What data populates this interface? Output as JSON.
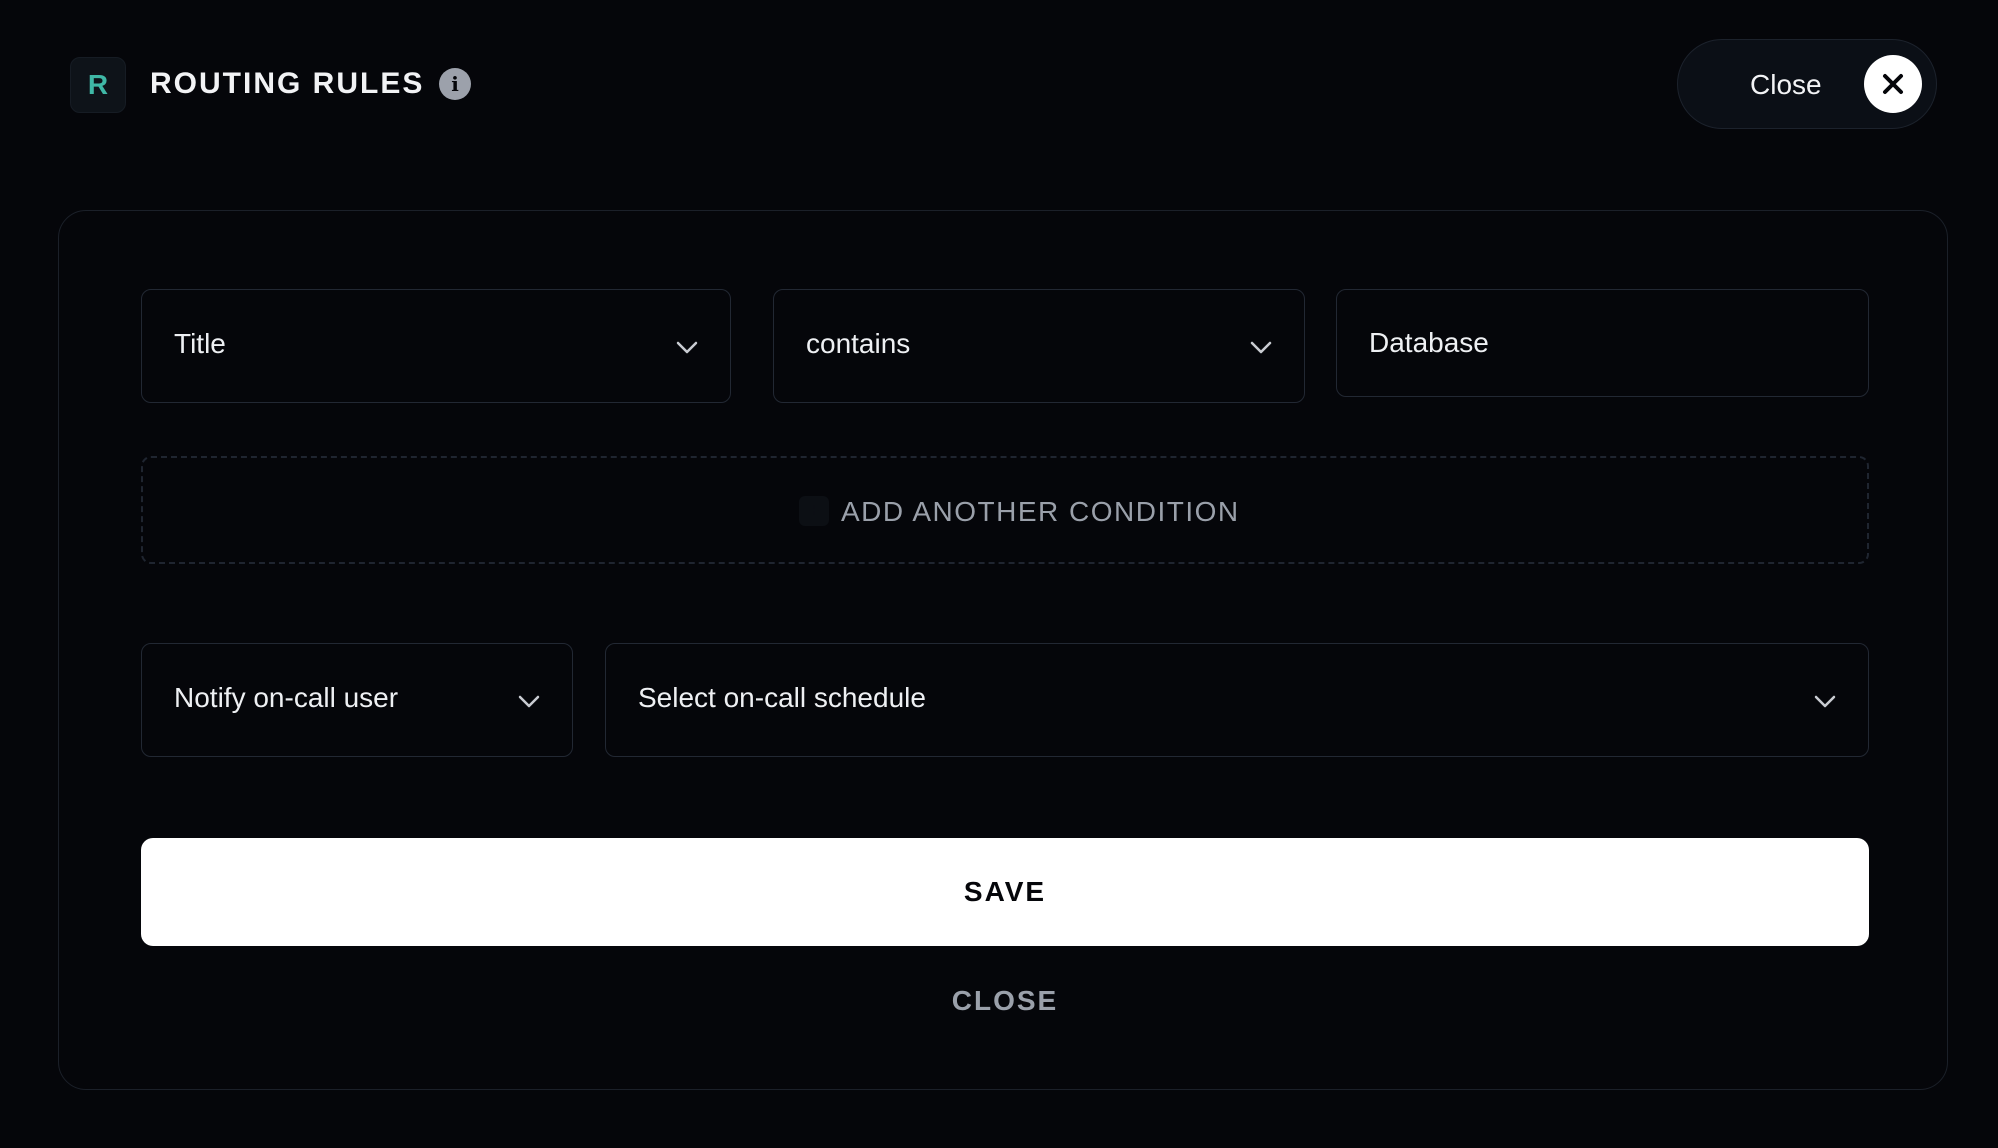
{
  "header": {
    "logo_letter": "R",
    "title": "ROUTING RULES",
    "info_icon": "i",
    "close_label": "Close"
  },
  "condition": {
    "field": {
      "value": "Title"
    },
    "operator": {
      "value": "contains"
    },
    "match_value": {
      "value": "Database",
      "placeholder": ""
    },
    "add_label": "ADD ANOTHER CONDITION"
  },
  "action": {
    "type": {
      "value": "Notify on-call user"
    },
    "schedule": {
      "value": "Select on-call schedule"
    }
  },
  "footer": {
    "save_label": "SAVE",
    "close_label": "CLOSE"
  },
  "colors": {
    "background": "#05060a",
    "accent_teal": "#3fb8a6",
    "border": "#222833",
    "muted_text": "#9aa0aa"
  },
  "icons": {
    "logo": "logo-badge",
    "info": "info-icon",
    "close": "close-icon",
    "dropdown": "chevron-down-icon",
    "add": "plus-icon"
  }
}
